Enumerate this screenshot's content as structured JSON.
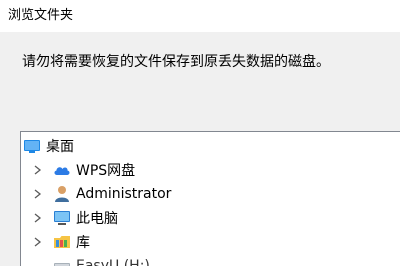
{
  "window": {
    "title": "浏览文件夹"
  },
  "instruction": "请勿将需要恢复的文件保存到原丢失数据的磁盘。",
  "tree": {
    "root": {
      "label": "桌面",
      "icon": "desktop-icon"
    },
    "items": [
      {
        "label": "WPS网盘",
        "icon": "cloud-icon",
        "expandable": true
      },
      {
        "label": "Administrator",
        "icon": "user-icon",
        "expandable": true
      },
      {
        "label": "此电脑",
        "icon": "computer-icon",
        "expandable": true
      },
      {
        "label": "库",
        "icon": "library-icon",
        "expandable": true
      },
      {
        "label": "EasyU (H:)",
        "icon": "drive-icon",
        "expandable": false
      }
    ]
  },
  "colors": {
    "tree_border": "#828790",
    "chevron": "#5a5a5a",
    "cloud_blue": "#2c7be5",
    "desktop_blue": "#1e88e5",
    "folder_yellow": "#f6c445"
  }
}
